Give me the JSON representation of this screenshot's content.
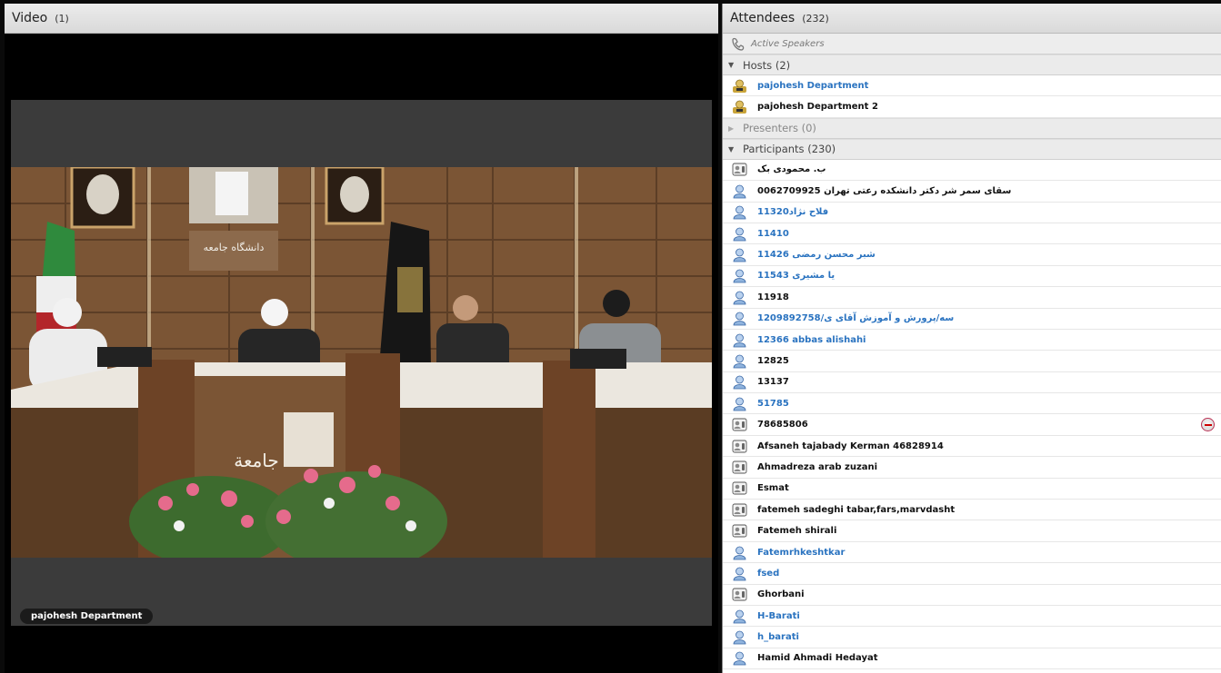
{
  "video_pod": {
    "title": "Video",
    "count": "(1)",
    "speaker_name": "pajohesh Department"
  },
  "attendees_pod": {
    "title": "Attendees",
    "count": "(232)",
    "active_speakers_label": "Active Speakers",
    "hosts": {
      "label": "Hosts (2)",
      "users": [
        {
          "name": "pajohesh Department",
          "color": "#2a73c0"
        },
        {
          "name": "pajohesh Department 2",
          "color": "#111111"
        }
      ]
    },
    "presenters": {
      "label": "Presenters (0)"
    },
    "participants": {
      "label": "Participants (230)",
      "users": [
        {
          "name": "ب. محمودی بک",
          "icon": "phone-user-icon",
          "color": "#111111"
        },
        {
          "name": "0062709925 سقای سمر شر دکتر دانشکده رعتی تهران",
          "icon": "user-icon",
          "color": "#111111"
        },
        {
          "name": "11320فلاح نژاد",
          "icon": "user-icon",
          "color": "#2a73c0"
        },
        {
          "name": "11410",
          "icon": "user-icon",
          "color": "#2a73c0"
        },
        {
          "name": "11426 شبر محسن رمضی",
          "icon": "user-icon",
          "color": "#2a73c0"
        },
        {
          "name": "11543 یا مشیری",
          "icon": "user-icon",
          "color": "#2a73c0"
        },
        {
          "name": "11918",
          "icon": "user-icon",
          "color": "#111111"
        },
        {
          "name": "1209892758/سه/پرورش و آموزش آقای ی",
          "icon": "user-icon",
          "color": "#2a73c0"
        },
        {
          "name": "12366 abbas alishahi",
          "icon": "user-icon",
          "color": "#2a73c0"
        },
        {
          "name": "12825",
          "icon": "user-icon",
          "color": "#111111"
        },
        {
          "name": "13137",
          "icon": "user-icon",
          "color": "#111111"
        },
        {
          "name": "51785",
          "icon": "user-icon",
          "color": "#2a73c0"
        },
        {
          "name": "78685806",
          "icon": "phone-user-icon",
          "color": "#111111",
          "status": true
        },
        {
          "name": "Afsaneh tajabady Kerman  46828914",
          "icon": "phone-user-icon",
          "color": "#111111"
        },
        {
          "name": "Ahmadreza arab zuzani",
          "icon": "phone-user-icon",
          "color": "#111111"
        },
        {
          "name": "Esmat",
          "icon": "phone-user-icon",
          "color": "#111111"
        },
        {
          "name": "fatemeh sadeghi tabar,fars,marvdasht",
          "icon": "phone-user-icon",
          "color": "#111111"
        },
        {
          "name": "Fatemeh shirali",
          "icon": "phone-user-icon",
          "color": "#111111"
        },
        {
          "name": "Fatemrhkeshtkar",
          "icon": "user-icon",
          "color": "#2a73c0"
        },
        {
          "name": "fsed",
          "icon": "user-icon",
          "color": "#2a73c0"
        },
        {
          "name": "Ghorbani",
          "icon": "phone-user-icon",
          "color": "#111111"
        },
        {
          "name": "H-Barati",
          "icon": "user-icon",
          "color": "#2a73c0"
        },
        {
          "name": "h_barati",
          "icon": "user-icon",
          "color": "#2a73c0"
        },
        {
          "name": "Hamid Ahmadi Hedayat",
          "icon": "user-icon",
          "color": "#111111"
        }
      ]
    }
  }
}
